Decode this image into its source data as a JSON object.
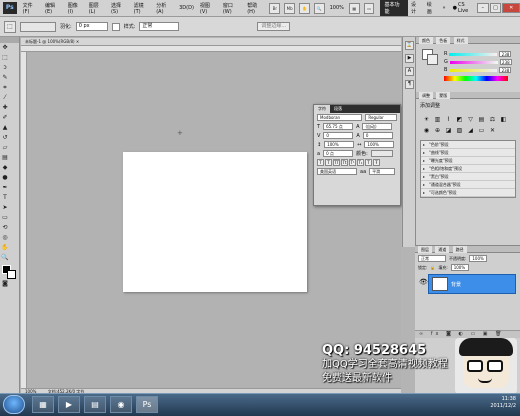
{
  "app": {
    "logo": "Ps",
    "menu": [
      "文件(F)",
      "编辑(E)",
      "图像(I)",
      "图层(L)",
      "选择(S)",
      "滤镜(T)",
      "分析(A)",
      "3D(D)",
      "视图(V)",
      "窗口(W)",
      "帮助(H)"
    ],
    "zoom": "100%",
    "workspace_active": "基本功能",
    "workspace_items": [
      "设计",
      "绘画",
      "»"
    ],
    "cs_live": "CS Live"
  },
  "options": {
    "feather_label": "羽化:",
    "feather_value": "0 px",
    "style_label": "样式:",
    "style_value": "正常",
    "refine_button": "调整边缘..."
  },
  "document": {
    "tab_title": "未标题-1 @ 100%(RGB/8)",
    "status_zoom": "100%",
    "status_doc": "文档:452.2K/0 字节"
  },
  "color_panel": {
    "tabs": [
      "颜色",
      "色板",
      "样式"
    ],
    "r": "238",
    "g": "238",
    "b": "238",
    "swatch_color": "#eeeeee"
  },
  "adjustments_panel": {
    "tabs": [
      "调整",
      "蒙版"
    ],
    "title": "添加调整",
    "presets": [
      "\"色阶\"预设",
      "\"曲线\"预设",
      "\"曝光度\"预设",
      "\"色相/饱和度\"预设",
      "\"黑白\"预设",
      "\"通道混合器\"预设",
      "\"可选颜色\"预设"
    ]
  },
  "character_panel": {
    "tabs": [
      "字符",
      "段落"
    ],
    "font_family": "Modboran",
    "font_style": "Regular",
    "size": "65.75 点",
    "leading": "(自动)",
    "kerning": "0",
    "tracking": "0",
    "vscale": "100%",
    "hscale": "100%",
    "baseline": "0 点",
    "color_label": "颜色:",
    "language": "美国英语",
    "antialias": "平滑"
  },
  "layers_panel": {
    "tabs": [
      "图层",
      "通道",
      "路径"
    ],
    "blend": "正常",
    "opacity_label": "不透明度:",
    "opacity": "100%",
    "fill_label": "填充:",
    "fill": "100%",
    "lock_label": "锁定:",
    "layer_name": "背景"
  },
  "promo": {
    "qq": "QQ: 94528645",
    "line1": "加QQ学习全套高清视频教程",
    "line2": "免费送最新软件"
  },
  "taskbar": {
    "time": "11:38",
    "date": "2011/12/2"
  }
}
